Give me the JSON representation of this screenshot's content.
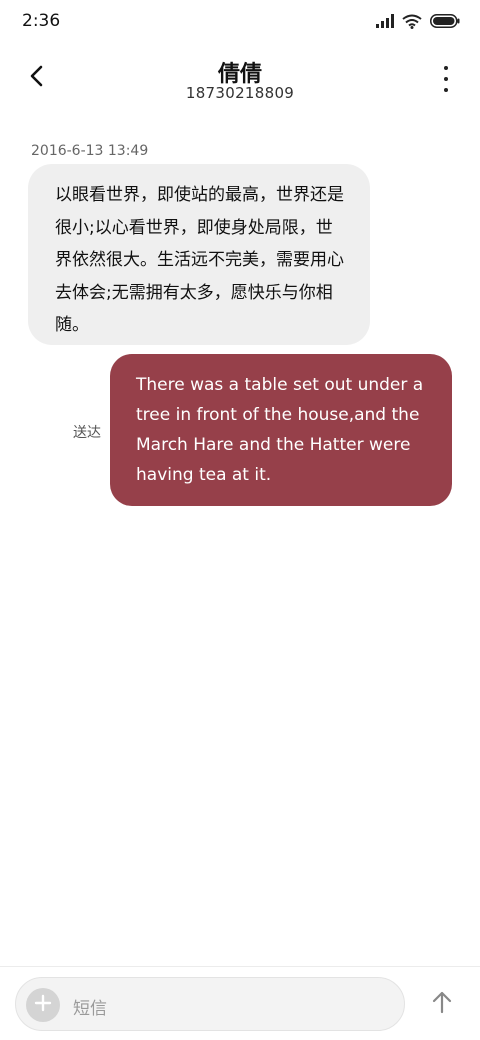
{
  "status_bar": {
    "time": "2:36",
    "icons": [
      "signal-icon",
      "wifi-icon",
      "battery-icon"
    ]
  },
  "header": {
    "contact_name": "倩倩",
    "contact_number": "18730218809",
    "back_icon": "chevron-left-icon",
    "more_icon": "more-vertical-icon"
  },
  "conversation": {
    "timestamp": "2016-6-13 13:49",
    "incoming": {
      "text": "以眼看世界，即使站的最高，世界还是很小;以心看世界，即使身处局限，世界依然很大。生活远不完美，需要用心去体会;无需拥有太多，愿快乐与你相随。"
    },
    "outgoing": {
      "text": "There was a table set out under a tree in front of the house,and the March Hare and the Hatter were having tea at it.",
      "status": "送达"
    }
  },
  "composer": {
    "placeholder": "短信",
    "add_icon": "plus-icon",
    "send_icon": "arrow-up-icon"
  },
  "colors": {
    "outgoing_bubble": "#96404a",
    "incoming_bubble": "#efefef"
  }
}
